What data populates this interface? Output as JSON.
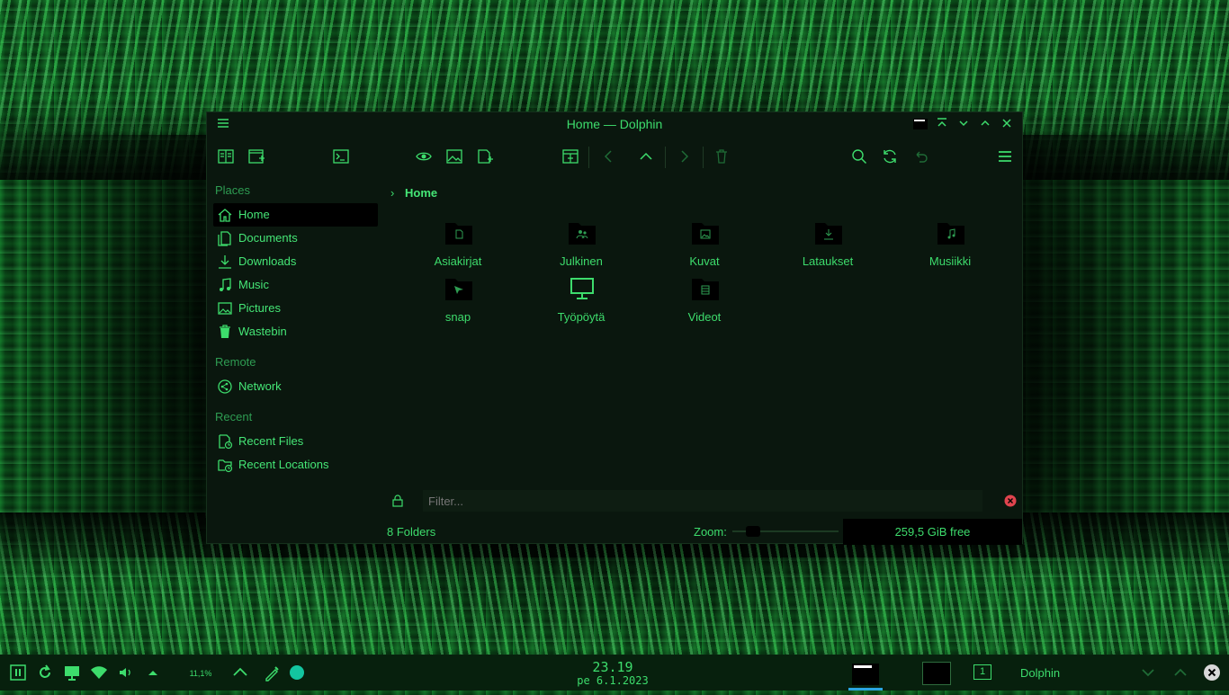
{
  "window": {
    "title": "Home — Dolphin"
  },
  "sidebar": {
    "places_heading": "Places",
    "places": [
      {
        "label": "Home",
        "icon": "home-icon",
        "active": true
      },
      {
        "label": "Documents",
        "icon": "documents-icon"
      },
      {
        "label": "Downloads",
        "icon": "downloads-icon"
      },
      {
        "label": "Music",
        "icon": "music-icon"
      },
      {
        "label": "Pictures",
        "icon": "pictures-icon"
      },
      {
        "label": "Wastebin",
        "icon": "wastebin-icon"
      }
    ],
    "remote_heading": "Remote",
    "remote": [
      {
        "label": "Network",
        "icon": "network-icon"
      }
    ],
    "recent_heading": "Recent",
    "recent": [
      {
        "label": "Recent Files",
        "icon": "recent-files-icon"
      },
      {
        "label": "Recent Locations",
        "icon": "recent-locations-icon"
      }
    ]
  },
  "breadcrumb": {
    "current": "Home"
  },
  "folders": [
    {
      "label": "Asiakirjat",
      "icon": "documents-folder-icon"
    },
    {
      "label": "Julkinen",
      "icon": "public-folder-icon"
    },
    {
      "label": "Kuvat",
      "icon": "pictures-folder-icon"
    },
    {
      "label": "Lataukset",
      "icon": "downloads-folder-icon"
    },
    {
      "label": "Musiikki",
      "icon": "music-folder-icon"
    },
    {
      "label": "snap",
      "icon": "snap-folder-icon"
    },
    {
      "label": "Työpöytä",
      "icon": "desktop-folder-icon"
    },
    {
      "label": "Videot",
      "icon": "videos-folder-icon"
    }
  ],
  "filter": {
    "placeholder": "Filter..."
  },
  "status": {
    "summary": "8 Folders",
    "zoom_label": "Zoom:",
    "zoom_level": 0.15,
    "free_space": "259,5 GiB free"
  },
  "taskbar": {
    "cpu": "11,1%",
    "time": "23.19",
    "date": "pe 6.1.2023",
    "pager": "1",
    "active_task": "Dolphin"
  },
  "colors": {
    "accent": "#3ddc6c",
    "window_bg": "#0a170e",
    "taskbar_bg": "#07200d",
    "close_red": "#e0444e"
  }
}
